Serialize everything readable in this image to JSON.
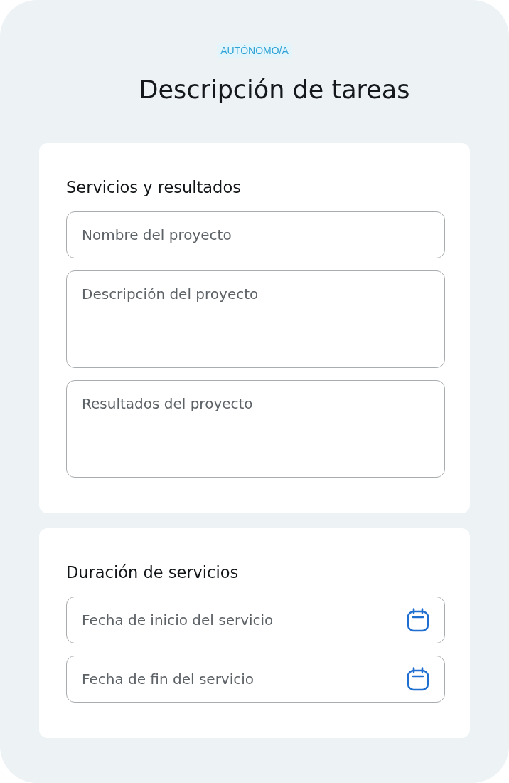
{
  "badge": "AUTÓNOMO/A",
  "title": "Descripción de tareas",
  "sections": [
    {
      "title": "Servicios y resultados",
      "fields": [
        {
          "kind": "text",
          "placeholder": "Nombre del proyecto"
        },
        {
          "kind": "textarea",
          "placeholder": "Descripción del proyecto"
        },
        {
          "kind": "textarea",
          "placeholder": "Resultados del proyecto"
        }
      ]
    },
    {
      "title": "Duración de servicios",
      "fields": [
        {
          "kind": "date",
          "placeholder": "Fecha de inicio del servicio"
        },
        {
          "kind": "date",
          "placeholder": "Fecha de fin del servicio"
        }
      ]
    }
  ]
}
